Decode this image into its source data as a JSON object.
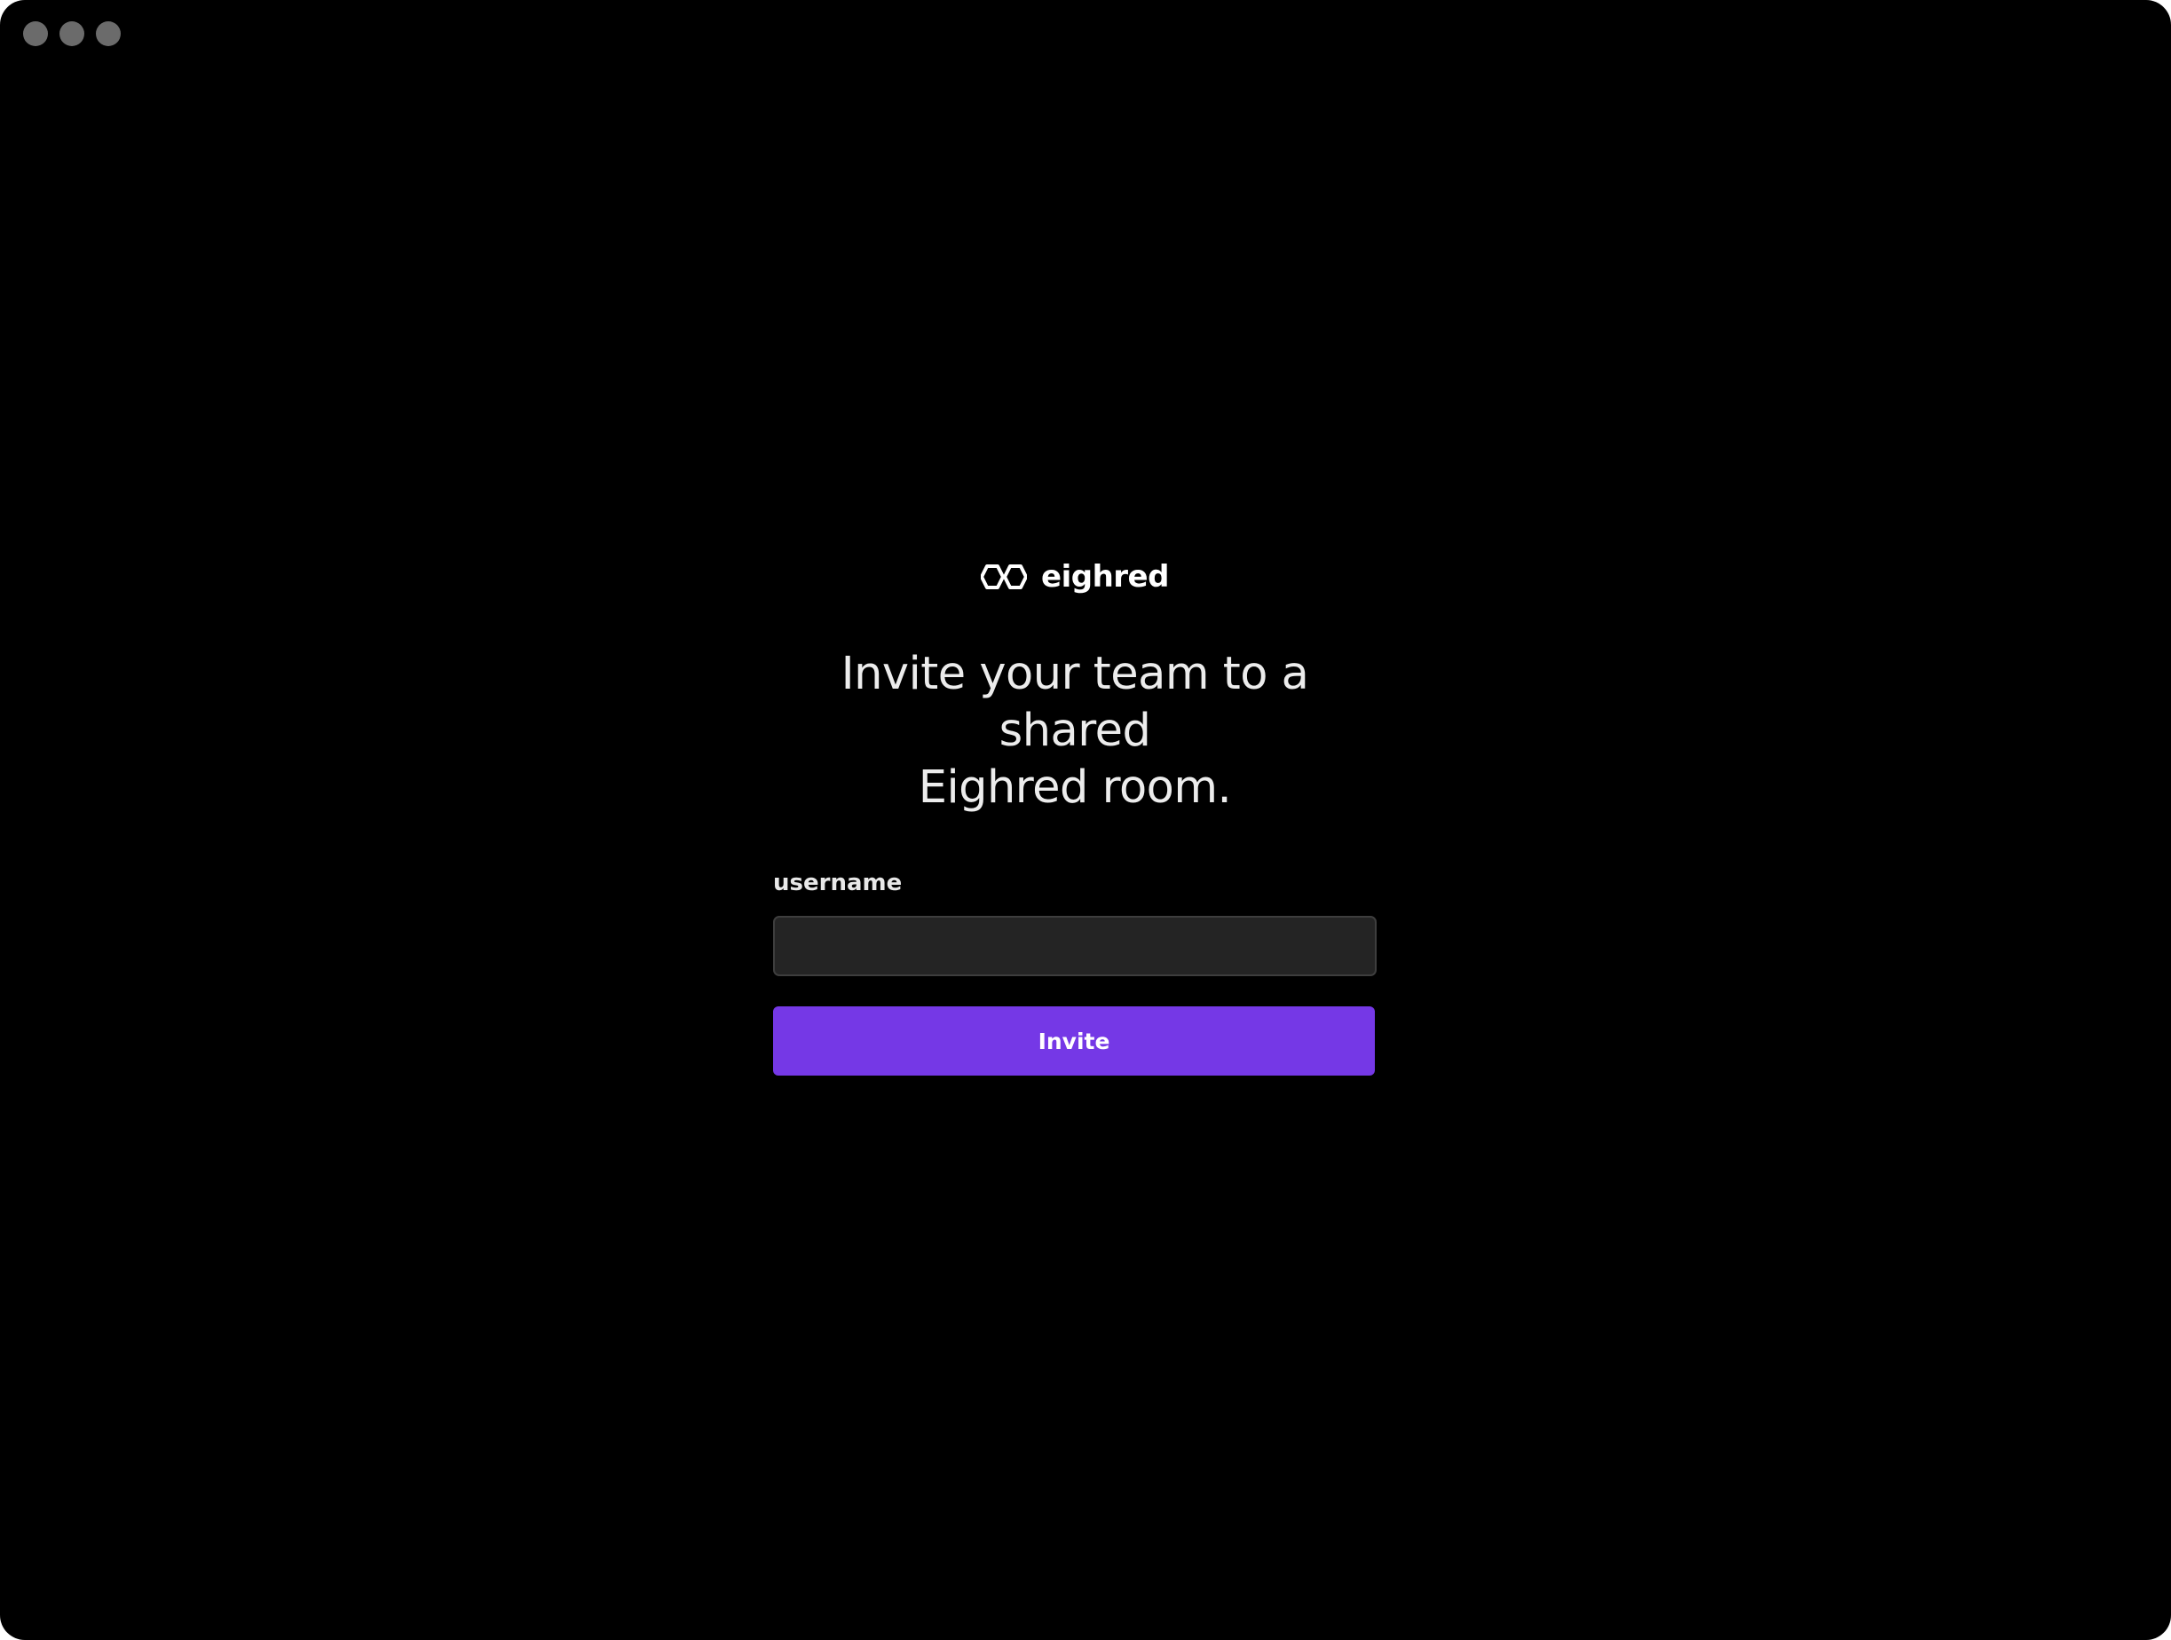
{
  "window": {
    "controls": [
      "close",
      "minimize",
      "zoom"
    ]
  },
  "brand": {
    "logo_icon": "double-hexagon-icon",
    "name": "eighred"
  },
  "main": {
    "heading": "Invite your team to a shared\nEighred room.",
    "username_label": "username",
    "username_value": "",
    "username_placeholder": "",
    "invite_label": "Invite"
  },
  "colors": {
    "background": "#000000",
    "input_background": "#242424",
    "accent": "#7538e6",
    "window_control": "#6b6b6b"
  }
}
